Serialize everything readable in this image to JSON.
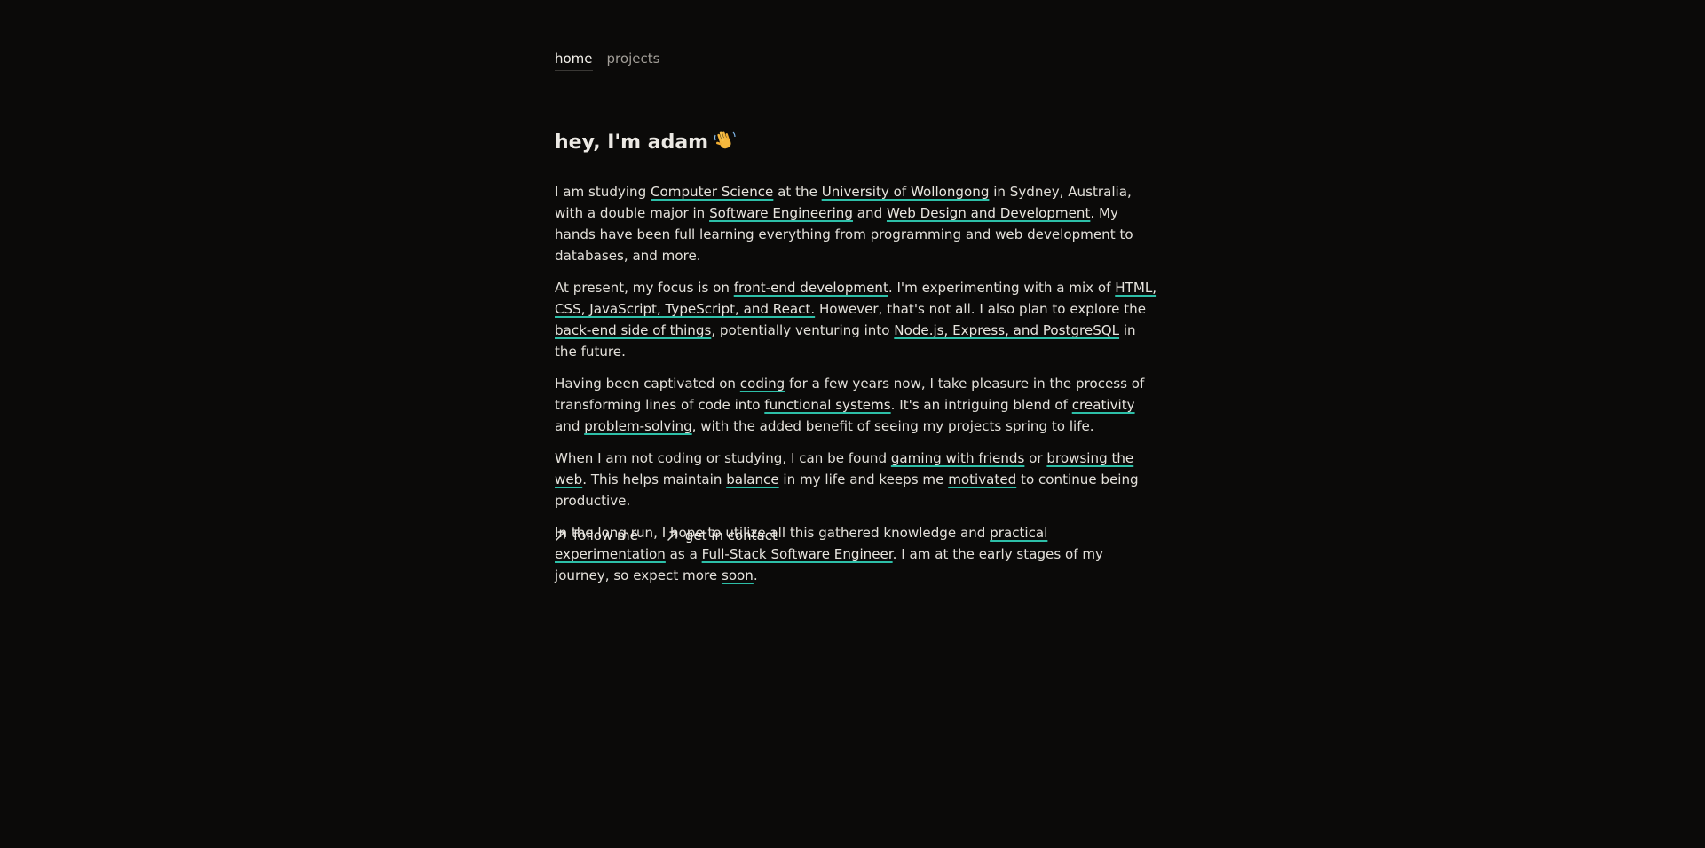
{
  "nav": {
    "home_label": "home",
    "projects_label": "projects"
  },
  "heading": {
    "text": "hey, I'm adam",
    "emoji_icon": "waving-hand-icon"
  },
  "paragraphs": [
    [
      {
        "text": "I am studying "
      },
      {
        "link": "Computer Science"
      },
      {
        "text": " at the "
      },
      {
        "link": "University of Wollongong"
      },
      {
        "text": " in Sydney, Australia, with a double major in "
      },
      {
        "link": "Software Engineering"
      },
      {
        "text": " and "
      },
      {
        "link": "Web Design and Development"
      },
      {
        "text": ". My hands have been full learning everything from programming and web development to databases, and more."
      }
    ],
    [
      {
        "text": "At present, my focus is on "
      },
      {
        "link": "front-end development"
      },
      {
        "text": ". I'm experimenting with a mix of "
      },
      {
        "link": "HTML, CSS, JavaScript, TypeScript, and React."
      },
      {
        "text": " However, that's not all. I also plan to explore the "
      },
      {
        "link": "back-end side of things"
      },
      {
        "text": ", potentially venturing into "
      },
      {
        "link": "Node.js, Express, and PostgreSQL"
      },
      {
        "text": " in the future."
      }
    ],
    [
      {
        "text": "Having been captivated on "
      },
      {
        "link": "coding"
      },
      {
        "text": " for a few years now, I take pleasure in the process of transforming lines of code into "
      },
      {
        "link": "functional systems"
      },
      {
        "text": ". It's an intriguing blend of "
      },
      {
        "link": "creativity"
      },
      {
        "text": " and "
      },
      {
        "link": "problem-solving"
      },
      {
        "text": ", with the added benefit of seeing my projects spring to life."
      }
    ],
    [
      {
        "text": "When I am not coding or studying, I can be found "
      },
      {
        "link": "gaming with friends"
      },
      {
        "text": " or "
      },
      {
        "link": "browsing the web"
      },
      {
        "text": ". This helps maintain "
      },
      {
        "link": "balance"
      },
      {
        "text": " in my life and keeps me "
      },
      {
        "link": "motivated"
      },
      {
        "text": " to continue being productive."
      }
    ],
    [
      {
        "text": "In the long run, I hope to utilize all this gathered knowledge and "
      },
      {
        "link": "practical experimentation"
      },
      {
        "text": " as a "
      },
      {
        "link": "Full-Stack Software Engineer"
      },
      {
        "text": ". I am at the early stages of my journey, so expect more "
      },
      {
        "link": "soon"
      },
      {
        "text": "."
      }
    ]
  ],
  "actions": {
    "follow_label": "follow me",
    "contact_label": "get in contact",
    "icon": "arrow-up-right-icon"
  },
  "colors": {
    "background": "#0b0a09",
    "text": "#e3e0da",
    "link_underline": "#2dbfa8",
    "muted": "#a29e98"
  }
}
